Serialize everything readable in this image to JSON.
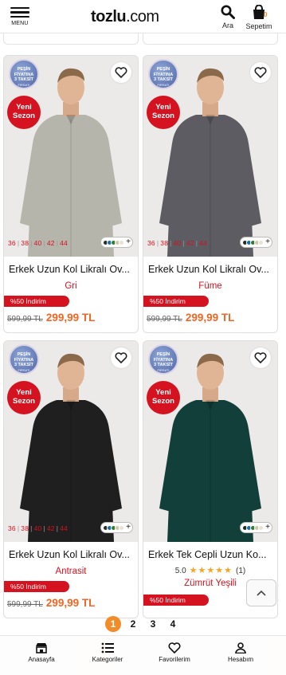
{
  "header": {
    "menu_label": "MENU",
    "logo_main": "tozlu",
    "logo_suffix": ".com",
    "search_label": "Ara",
    "cart_label": "Sepetim",
    "cart_count": "0",
    "accent": "#f28c28"
  },
  "badges": {
    "installment": [
      "PEŞİN",
      "FİYATINA",
      "3 TAKSİT",
      "FIRSATI"
    ],
    "new_season": [
      "Yeni",
      "Sezon"
    ]
  },
  "products": [
    {
      "sizes": [
        "36",
        "38",
        "40",
        "42",
        "44"
      ],
      "swatches": [
        "#2b2b2b",
        "#1b6fa8",
        "#2e7d32",
        "#cfc8a8",
        "#e8e2d2"
      ],
      "title": "Erkek Uzun Kol Likralı Ov...",
      "color": "Gri",
      "discount": "%50 İndirim",
      "old_price": "599,99 TL",
      "new_price": "299,99 TL",
      "shirt_color": "#b6b5ab"
    },
    {
      "sizes": [
        "36",
        "38",
        "40",
        "42",
        "44"
      ],
      "swatches": [
        "#2b2b2b",
        "#1b6fa8",
        "#2e7d32",
        "#cfc8a8",
        "#e8e2d2"
      ],
      "title": "Erkek Uzun Kol Likralı Ov...",
      "color": "Füme",
      "discount": "%50 İndirim",
      "old_price": "599,99 TL",
      "new_price": "299,99 TL",
      "shirt_color": "#5d5c62"
    },
    {
      "sizes": [
        "36",
        "38",
        "40",
        "42",
        "44"
      ],
      "swatches": [
        "#2b2b2b",
        "#1b6fa8",
        "#2e7d32",
        "#cfc8a8",
        "#e8e2d2"
      ],
      "title": "Erkek Uzun Kol Likralı Ov...",
      "color": "Antrasit",
      "discount": "%50 İndirim",
      "old_price": "599,99 TL",
      "new_price": "299,99 TL",
      "shirt_color": "#1f1f1f"
    },
    {
      "sizes": [],
      "swatches": [
        "#1e2a26",
        "#1b6fa8",
        "#2e7d32",
        "#cfc8a8",
        "#e8e2d2"
      ],
      "title": "Erkek Tek Cepli Uzun Ko...",
      "rating": "5.0",
      "rating_stars": "★★★★★",
      "rating_count": "(1)",
      "color": "Zümrüt Yeşili",
      "discount": "%50 İndirim",
      "old_price": "",
      "new_price": "",
      "shirt_color": "#123f3a"
    }
  ],
  "pagination": {
    "pages": [
      "1",
      "2",
      "3",
      "4"
    ],
    "current": "1"
  },
  "bottom_nav": {
    "home": "Anasayfa",
    "categories": "Kategoriler",
    "favorites": "Favorilerim",
    "account": "Hesabım"
  }
}
